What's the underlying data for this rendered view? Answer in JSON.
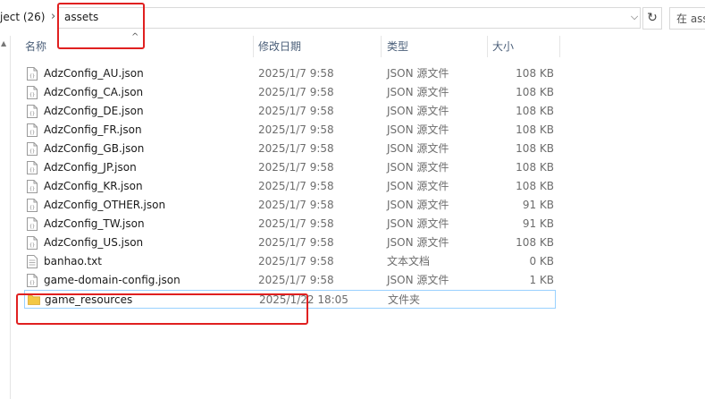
{
  "address_bar": {
    "previous_crumb": "ject (26)",
    "separator": "›",
    "current_folder": "assets",
    "dropdown_glyph": "⌵",
    "refresh_glyph": "↻",
    "search_placeholder": "在 ass"
  },
  "columns": {
    "name": "名称",
    "date": "修改日期",
    "type": "类型",
    "size": "大小"
  },
  "files": [
    {
      "name": "AdzConfig_AU.json",
      "date": "2025/1/7 9:58",
      "type": "JSON 源文件",
      "size": "108 KB",
      "icon": "json-file-icon"
    },
    {
      "name": "AdzConfig_CA.json",
      "date": "2025/1/7 9:58",
      "type": "JSON 源文件",
      "size": "108 KB",
      "icon": "json-file-icon"
    },
    {
      "name": "AdzConfig_DE.json",
      "date": "2025/1/7 9:58",
      "type": "JSON 源文件",
      "size": "108 KB",
      "icon": "json-file-icon"
    },
    {
      "name": "AdzConfig_FR.json",
      "date": "2025/1/7 9:58",
      "type": "JSON 源文件",
      "size": "108 KB",
      "icon": "json-file-icon"
    },
    {
      "name": "AdzConfig_GB.json",
      "date": "2025/1/7 9:58",
      "type": "JSON 源文件",
      "size": "108 KB",
      "icon": "json-file-icon"
    },
    {
      "name": "AdzConfig_JP.json",
      "date": "2025/1/7 9:58",
      "type": "JSON 源文件",
      "size": "108 KB",
      "icon": "json-file-icon"
    },
    {
      "name": "AdzConfig_KR.json",
      "date": "2025/1/7 9:58",
      "type": "JSON 源文件",
      "size": "108 KB",
      "icon": "json-file-icon"
    },
    {
      "name": "AdzConfig_OTHER.json",
      "date": "2025/1/7 9:58",
      "type": "JSON 源文件",
      "size": "91 KB",
      "icon": "json-file-icon"
    },
    {
      "name": "AdzConfig_TW.json",
      "date": "2025/1/7 9:58",
      "type": "JSON 源文件",
      "size": "91 KB",
      "icon": "json-file-icon"
    },
    {
      "name": "AdzConfig_US.json",
      "date": "2025/1/7 9:58",
      "type": "JSON 源文件",
      "size": "108 KB",
      "icon": "json-file-icon"
    },
    {
      "name": "banhao.txt",
      "date": "2025/1/7 9:58",
      "type": "文本文档",
      "size": "0 KB",
      "icon": "text-file-icon"
    },
    {
      "name": "game-domain-config.json",
      "date": "2025/1/7 9:58",
      "type": "JSON 源文件",
      "size": "1 KB",
      "icon": "json-file-icon"
    },
    {
      "name": "game_resources",
      "date": "2025/1/22 18:05",
      "type": "文件夹",
      "size": "",
      "icon": "folder-icon",
      "selected": true
    }
  ],
  "colors": {
    "annotation_red": "#e02020",
    "selection_border": "#99d1ff",
    "header_text": "#4c607a",
    "folder_yellow": "#f3c845"
  }
}
